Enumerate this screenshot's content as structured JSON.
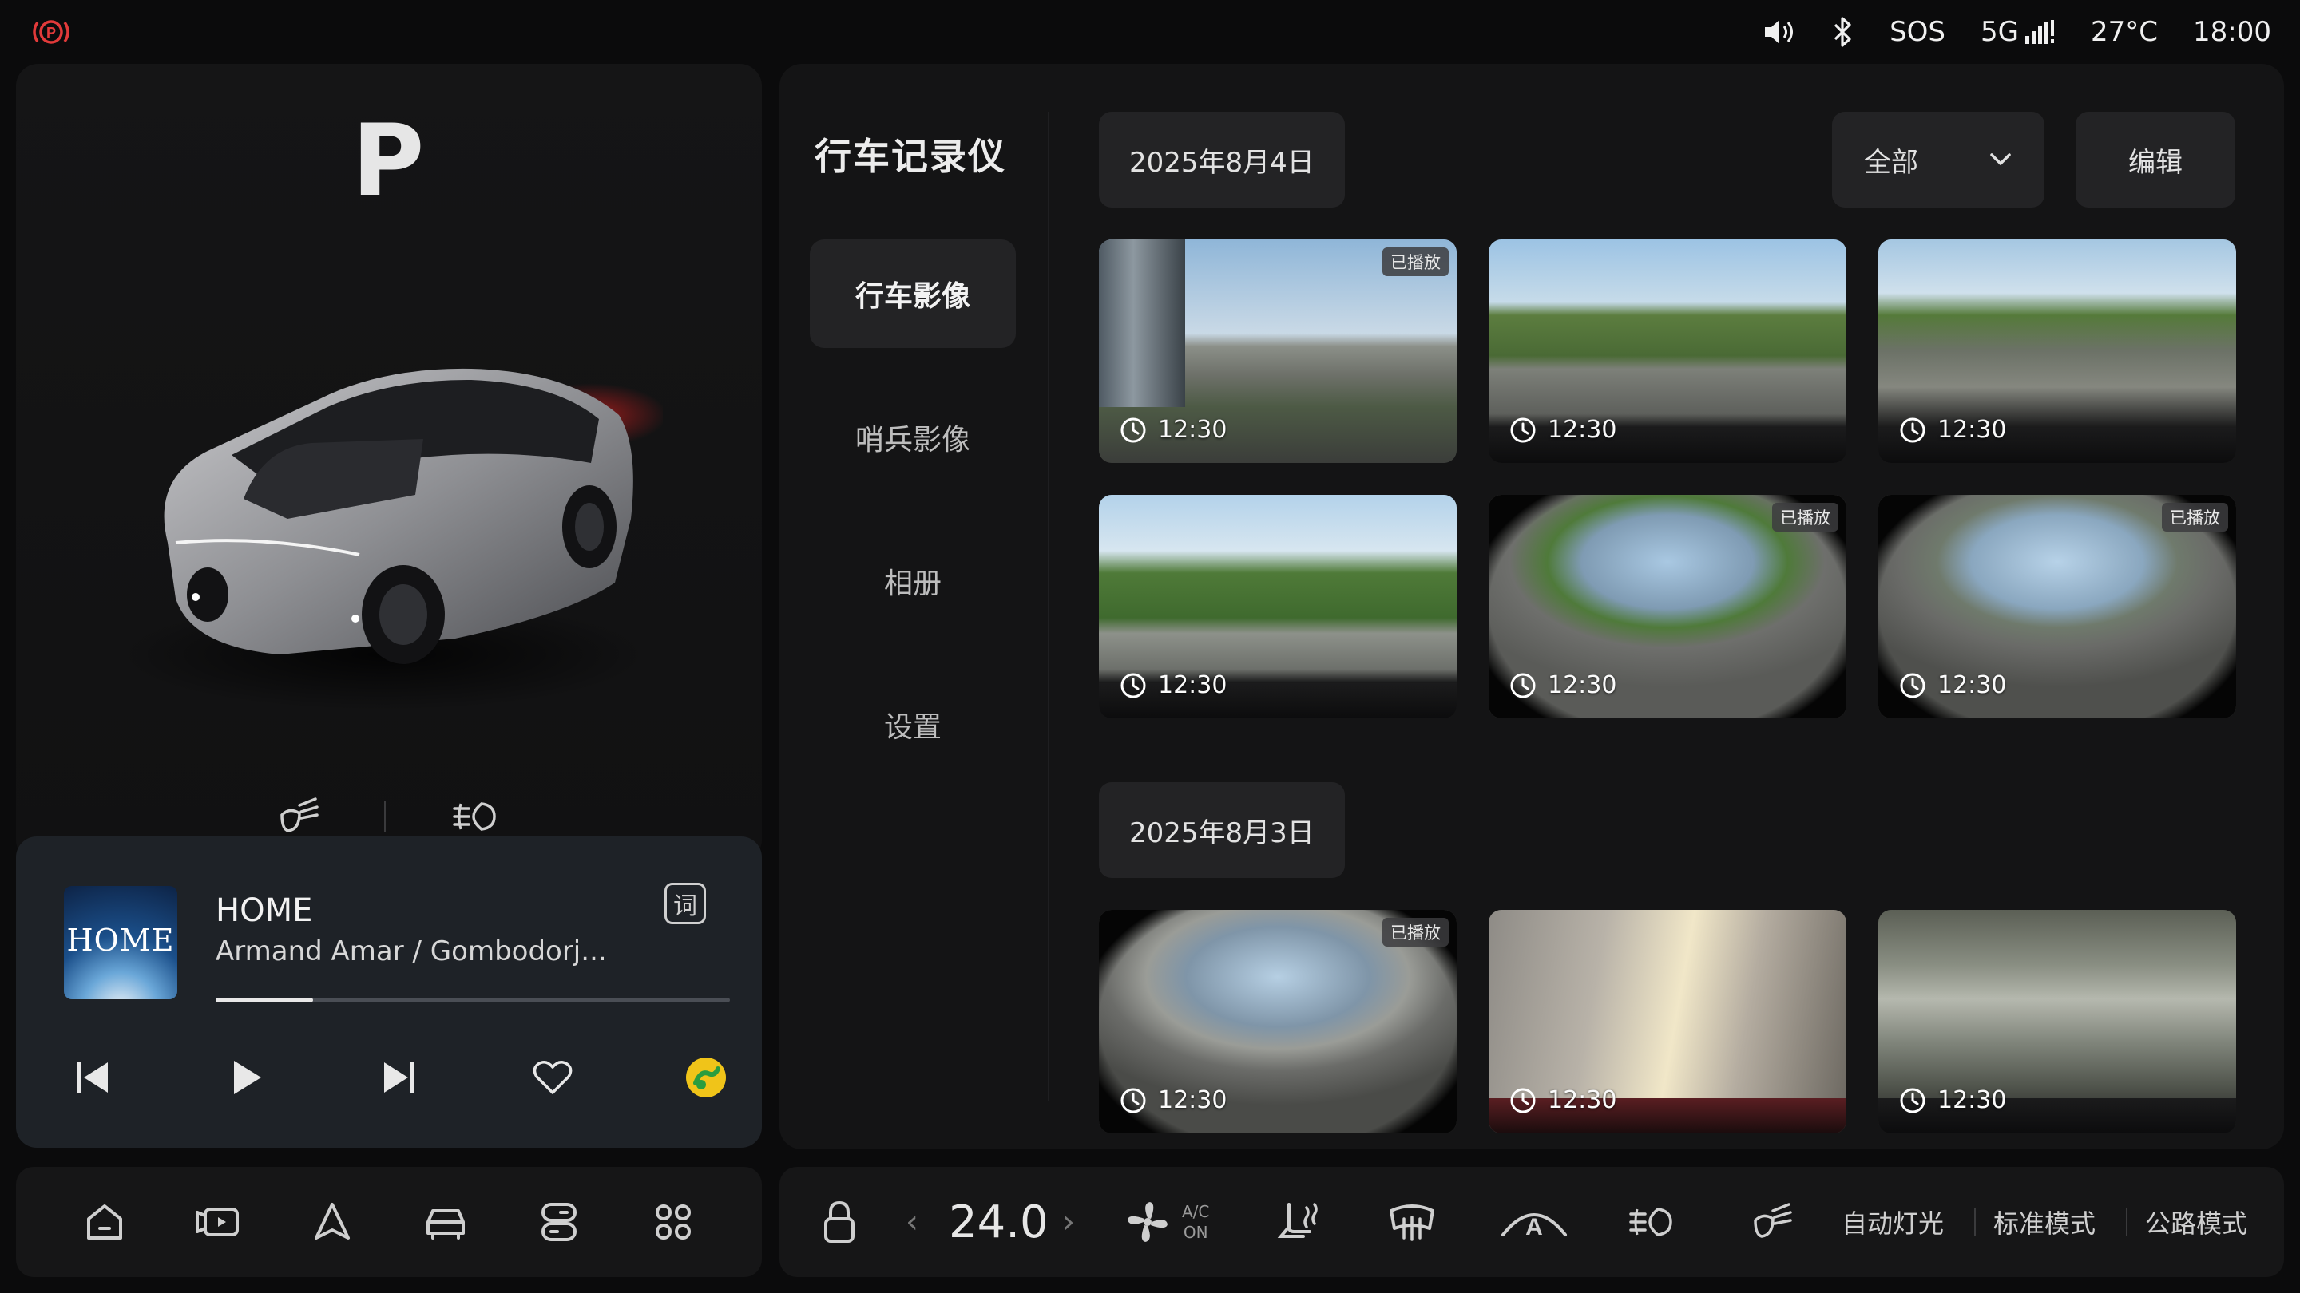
{
  "status": {
    "sos": "SOS",
    "signal": "5G",
    "temperature": "27°C",
    "time": "18:00",
    "icons": [
      "parking-brake-icon",
      "volume-icon",
      "bluetooth-icon",
      "signal-icon"
    ]
  },
  "vehicle": {
    "gear": "P"
  },
  "music": {
    "album_text": "HOME",
    "title": "HOME",
    "artist": "Armand Amar / Gombodorj...",
    "lyrics_icon": "词",
    "progress": 0.19
  },
  "recorder": {
    "title": "行车记录仪",
    "nav": [
      {
        "label": "行车影像",
        "active": true
      },
      {
        "label": "哨兵影像",
        "active": false
      },
      {
        "label": "相册",
        "active": false
      },
      {
        "label": "设置",
        "active": false
      }
    ],
    "filter": "全部",
    "edit": "编辑",
    "played_tag": "已播放",
    "groups": [
      {
        "date": "2025年8月4日",
        "clips": [
          {
            "time": "12:30",
            "played": true
          },
          {
            "time": "12:30",
            "played": false
          },
          {
            "time": "12:30",
            "played": false
          },
          {
            "time": "12:30",
            "played": false
          },
          {
            "time": "12:30",
            "played": true
          },
          {
            "time": "12:30",
            "played": true
          }
        ]
      },
      {
        "date": "2025年8月3日",
        "clips": [
          {
            "time": "12:30",
            "played": true
          },
          {
            "time": "12:30",
            "played": false
          },
          {
            "time": "12:30",
            "played": false
          }
        ]
      }
    ]
  },
  "climate": {
    "temperature": "24.0",
    "ac_line1": "A/C",
    "ac_line2": "ON",
    "modes": [
      "自动灯光",
      "标准模式",
      "公路模式"
    ]
  },
  "colors": {
    "background": "#0b0b0c",
    "panel": "#161617",
    "music_card": "#1e2227",
    "accent_red": "#e23a3a",
    "accent_yellow": "#f0c419"
  }
}
